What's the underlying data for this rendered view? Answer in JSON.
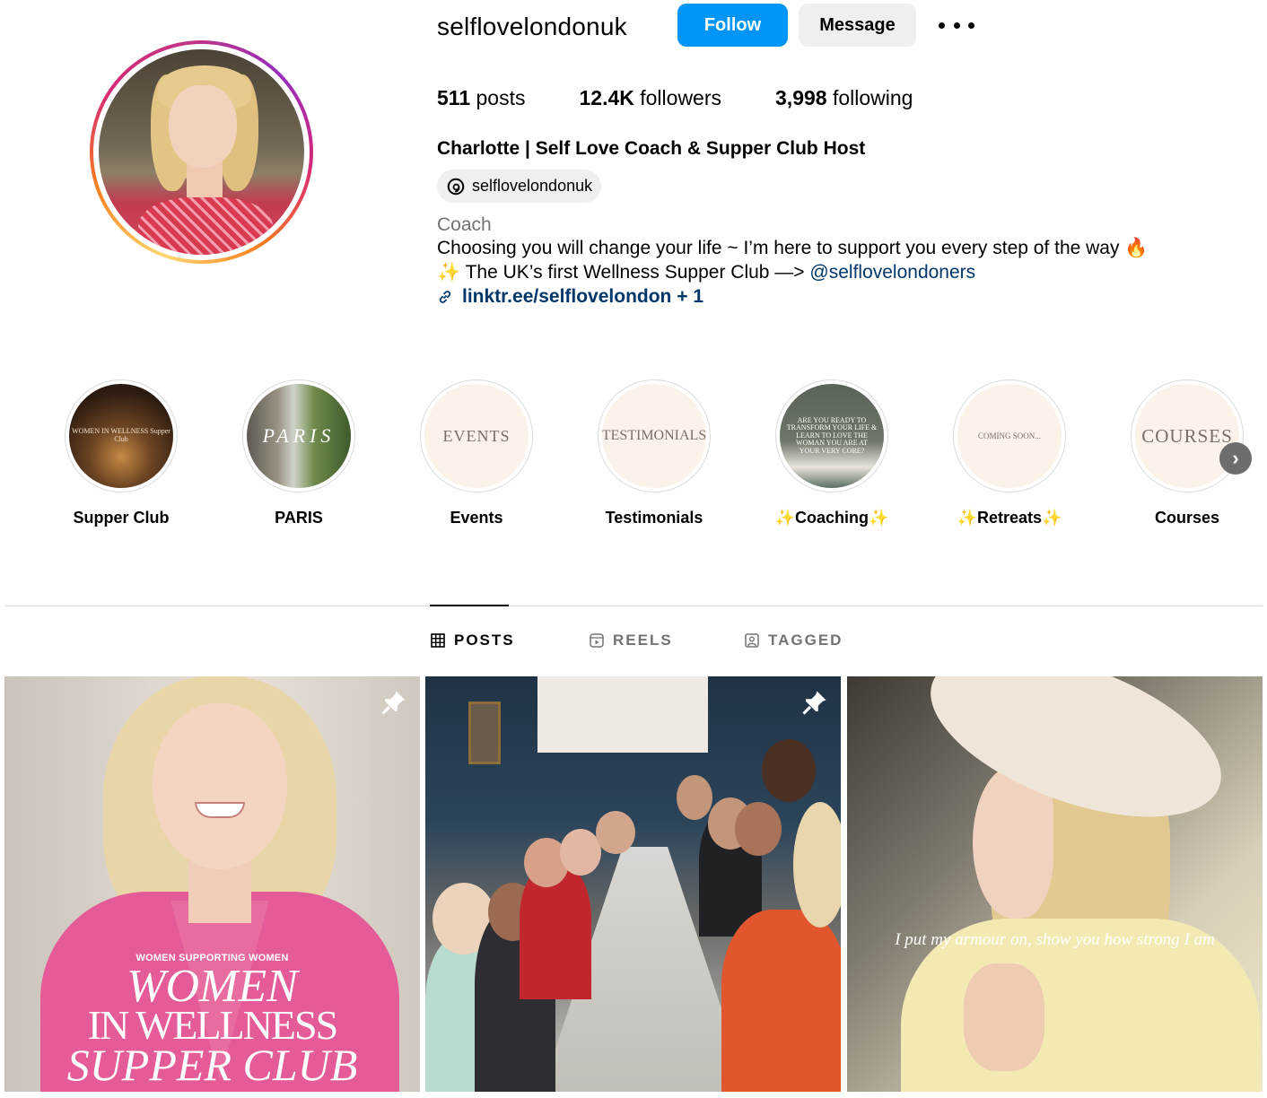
{
  "profile": {
    "username": "selflovelondonuk",
    "follow_label": "Follow",
    "message_label": "Message",
    "stats": [
      {
        "value": "511",
        "label": "posts"
      },
      {
        "value": "12.4K",
        "label": "followers"
      },
      {
        "value": "3,998",
        "label": "following"
      }
    ],
    "full_name": "Charlotte | Self Love Coach & Supper Club Host",
    "threads_handle": "selflovelondonuk",
    "category": "Coach",
    "bio_line1": "Choosing you will change your life ~ I’m here to support you every step of the way 🔥",
    "bio_line2_prefix": "✨ The UK’s first Wellness Supper Club —> ",
    "bio_mention": "@selflovelondoners",
    "link": "linktr.ee/selflovelondon + 1"
  },
  "highlights": [
    {
      "label": "Supper Club",
      "cover_text": "WOMEN IN WELLNESS Supper Club"
    },
    {
      "label": "PARIS",
      "cover_text": "PARIS"
    },
    {
      "label": "Events",
      "cover_text": "EVENTS"
    },
    {
      "label": "Testimonials",
      "cover_text": "TESTIMONIALS"
    },
    {
      "label": "✨Coaching✨",
      "cover_text": "ARE YOU READY TO TRANSFORM YOUR LIFE & LEARN TO LOVE THE WOMAN YOU ARE AT YOUR VERY CORE?"
    },
    {
      "label": "✨Retreats✨",
      "cover_text": "COMING SOON..."
    },
    {
      "label": "Courses",
      "cover_text": "COURSES"
    }
  ],
  "tabs": [
    {
      "label": "POSTS",
      "active": true
    },
    {
      "label": "REELS",
      "active": false
    },
    {
      "label": "TAGGED",
      "active": false
    }
  ],
  "posts": [
    {
      "kicker": "WOMEN SUPPORTING WOMEN",
      "line1": "WOMEN",
      "line2": "IN WELLNESS",
      "line3": "SUPPER CLUB",
      "pinned": true
    },
    {
      "pinned": true
    },
    {
      "caption": "I put my armour on, show you how strong I am",
      "pinned": false
    }
  ],
  "colors": {
    "accent": "#0095f6",
    "link": "#00376b",
    "muted": "#737373"
  }
}
